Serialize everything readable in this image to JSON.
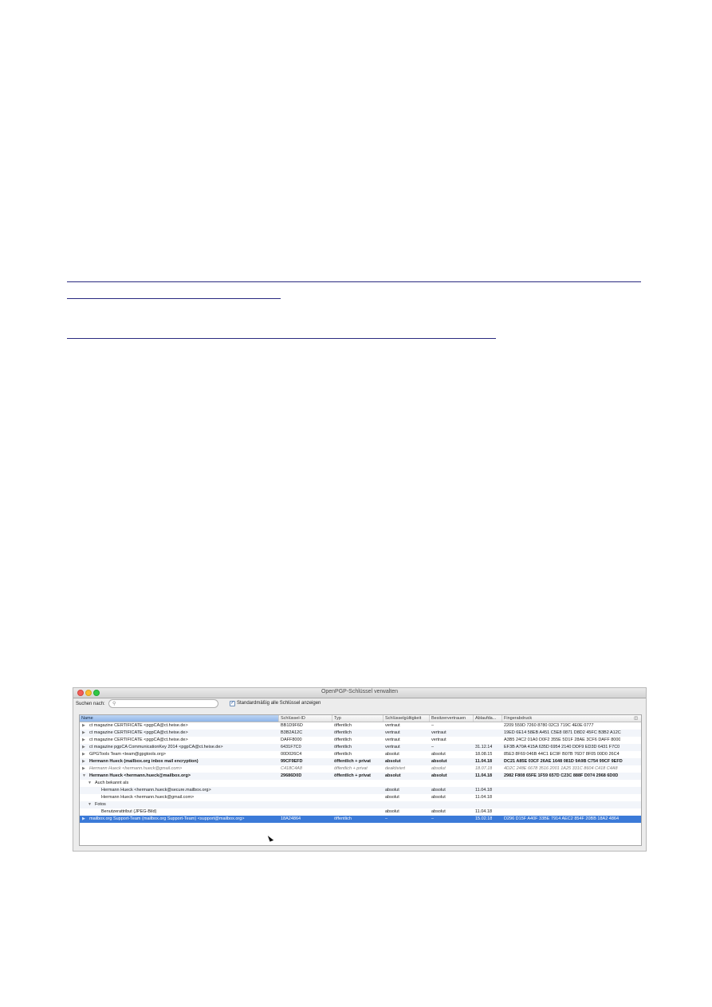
{
  "window": {
    "title": "OpenPGP-Schlüssel verwalten"
  },
  "search": {
    "label": "Suchen nach:",
    "value": "",
    "icon": "magnifier-icon"
  },
  "show_all": {
    "label": "Standardmäßig alle Schlüssel anzeigen",
    "checked": true
  },
  "columns": [
    "Name",
    "Schlüssel-ID",
    "Typ",
    "Schlüsselgültigkeit",
    "Besitzervertrauen",
    "Ablaufda...",
    "Fingerabdruck"
  ],
  "rows": [
    {
      "name": "ct magazine CERTIFICATE <pgpCA@ct.heise.de>",
      "key_id": "BB1D9F6D",
      "type": "öffentlich",
      "validity": "vertraut",
      "trust": "–",
      "expiry": "",
      "fingerprint": "2209 559D 7260 8780 02C3 719C 4E0E 0777"
    },
    {
      "name": "ct magazine CERTIFICATE <pgpCA@ct.heise.de>",
      "key_id": "B3B2A12C",
      "type": "öffentlich",
      "validity": "vertraut",
      "trust": "vertraut",
      "expiry": "",
      "fingerprint": "19ED 6E14 58EB A451 C5E8 0871 D8D2 45FC B3B2 A12C"
    },
    {
      "name": "ct magazine CERTIFICATE <pgpCA@ct.heise.de>",
      "key_id": "DAFF8000",
      "type": "öffentlich",
      "validity": "vertraut",
      "trust": "vertraut",
      "expiry": "",
      "fingerprint": "A3B5 24C2 01A0 D0F2 355E 5D1F 28AE 3CF6 DAFF 8000"
    },
    {
      "name": "ct magazine pgpCA CommunicationKey 2014 <pgpCA@ct.heise.de>",
      "key_id": "6431F7C0",
      "type": "öffentlich",
      "validity": "vertraut",
      "trust": "–",
      "expiry": "31.12.14",
      "fingerprint": "EF3B A70A 415A 635D 6954 2140 DDF9 ED3D 6431 F7C0"
    },
    {
      "name": "GPGTools Team <team@gpgtools.org>",
      "key_id": "00D026C4",
      "type": "öffentlich",
      "validity": "absolut",
      "trust": "absolut",
      "expiry": "18.08.15",
      "fingerprint": "85E3 8F69 046B 44C1 EC9F B07B 76D7 8F05 00D0 26C4"
    },
    {
      "name": "Hermann Hueck (mailbox.org inbox mail encryption)",
      "key_id": "99CF9EFD",
      "type": "öffentlich + privat",
      "validity": "absolut",
      "trust": "absolut",
      "expiry": "11.04.18",
      "fingerprint": "DC21 A85E 03CF 26AE 1648 081D 9A9B C754 99CF 9EFD"
    },
    {
      "name": "Hermann Hueck <hermann.hueck@gmail.com>",
      "key_id": "C418C4A8",
      "type": "öffentlich + privat",
      "validity": "deaktiviert",
      "trust": "absolut",
      "expiry": "18.07.18",
      "fingerprint": "4D2C 248E 6678 3516 2001 1A25 331C 8604 C418 C4A8"
    },
    {
      "name": "Hermann Hueck <hermann.hueck@mailbox.org>",
      "key_id": "29686D0D",
      "type": "öffentlich + privat",
      "validity": "absolut",
      "trust": "absolut",
      "expiry": "11.04.18",
      "fingerprint": "2982 F808 65FE 1F59 657D C23C 888F D074 2968 6D0D"
    },
    {
      "name": "Auch bekannt als",
      "key_id": "",
      "type": "",
      "validity": "",
      "trust": "",
      "expiry": "",
      "fingerprint": ""
    },
    {
      "name": "Hermann Hueck <hermann.hueck@secure.mailbox.org>",
      "key_id": "",
      "type": "",
      "validity": "absolut",
      "trust": "absolut",
      "expiry": "11.04.18",
      "fingerprint": ""
    },
    {
      "name": "Hermann Hueck <hermann.hueck@gmail.com>",
      "key_id": "",
      "type": "",
      "validity": "absolut",
      "trust": "absolut",
      "expiry": "11.04.18",
      "fingerprint": ""
    },
    {
      "name": "Fotos",
      "key_id": "",
      "type": "",
      "validity": "",
      "trust": "",
      "expiry": "",
      "fingerprint": ""
    },
    {
      "name": "Benutzerattribut (JPEG-Bild)",
      "key_id": "",
      "type": "",
      "validity": "absolut",
      "trust": "absolut",
      "expiry": "11.04.18",
      "fingerprint": ""
    },
    {
      "name": "mailbox.org Support-Team (mailbox.org Support-Team) <support@mailbox.org>",
      "key_id": "18A24864",
      "type": "öffentlich",
      "validity": "–",
      "trust": "–",
      "expiry": "15.02.18",
      "fingerprint": "D296 D15F A40F 33BE 7914 AEC2 854F 20BB 18A2 4864"
    }
  ]
}
